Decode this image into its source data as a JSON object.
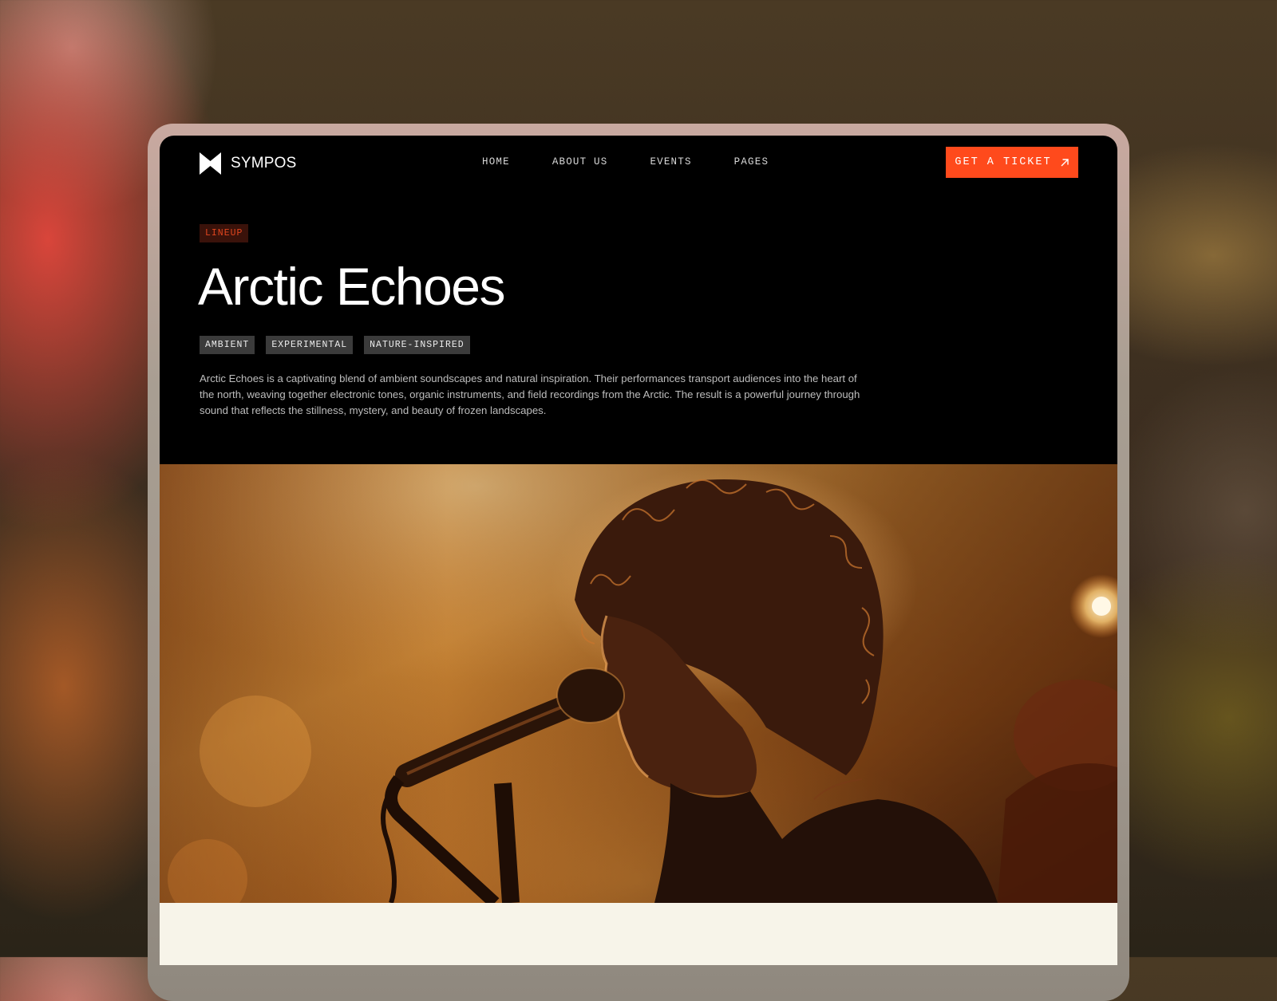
{
  "brand": {
    "name": "SYMPOS",
    "logo_icon": "bowtie-logo-icon"
  },
  "nav": {
    "items": [
      {
        "label": "HOME"
      },
      {
        "label": "ABOUT US"
      },
      {
        "label": "EVENTS"
      },
      {
        "label": "PAGES"
      }
    ],
    "cta": {
      "label": "GET A TICKET",
      "icon": "arrow-up-right-icon"
    }
  },
  "hero": {
    "section_tag": "LINEUP",
    "title": "Arctic Echoes",
    "genres": [
      "AMBIENT",
      "EXPERIMENTAL",
      "NATURE-INSPIRED"
    ],
    "description": "Arctic Echoes is a captivating blend of ambient soundscapes and natural inspiration. Their performances transport audiences into the heart of the north, weaving together electronic tones, organic instruments, and field recordings from the Arctic. The result is a powerful journey through sound that reflects the stillness, mystery, and beauty of frozen landscapes."
  },
  "colors": {
    "accent": "#ff4a1c",
    "page_bg": "#000000",
    "tag_bg": "#3a120a",
    "tag_text": "#e2461f",
    "genre_bg": "#3b3b3b",
    "next_section_bg": "#f7f4e9"
  }
}
